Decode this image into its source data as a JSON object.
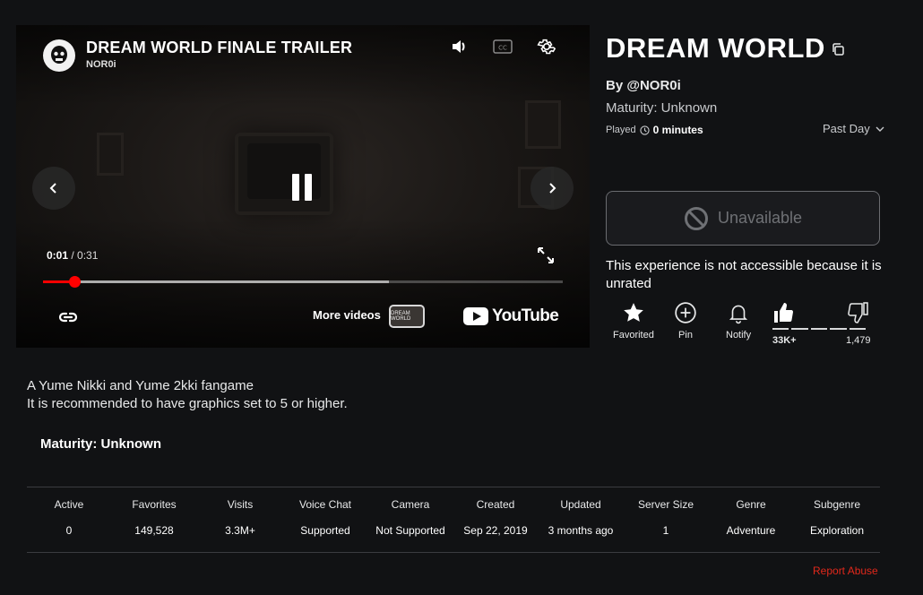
{
  "video": {
    "title": "DREAM WORLD FINALE TRAILER",
    "channel": "NOR0i",
    "current_time": "0:01",
    "duration": "/ 0:31",
    "progress_fraction": 0.06,
    "buffered_fraction": 0.665,
    "more_videos_label": "More videos",
    "more_thumb_text": "DREAM WORLD",
    "youtube_label": "YouTube",
    "icons": [
      "volume-icon",
      "captions-icon",
      "settings-icon",
      "prev-icon",
      "next-icon",
      "pause-icon",
      "fullscreen-icon",
      "link-icon"
    ]
  },
  "game": {
    "title": "DREAM WORLD",
    "by": "By @NOR0i",
    "maturity": "Maturity: Unknown",
    "played_label": "Played",
    "played_value": "0 minutes",
    "period": "Past Day",
    "unavailable_label": "Unavailable",
    "not_accessible": "This experience is not accessible because it is unrated"
  },
  "actions": {
    "favorited": "Favorited",
    "pin": "Pin",
    "notify": "Notify",
    "upvotes": "33K+",
    "downvotes": "1,479"
  },
  "description": {
    "line1": "A Yume Nikki and Yume 2kki fangame",
    "line2": "It is recommended to have graphics set to 5 or higher.",
    "maturity": "Maturity: Unknown"
  },
  "stats": [
    {
      "label": "Active",
      "value": "0"
    },
    {
      "label": "Favorites",
      "value": "149,528"
    },
    {
      "label": "Visits",
      "value": "3.3M+"
    },
    {
      "label": "Voice Chat",
      "value": "Supported"
    },
    {
      "label": "Camera",
      "value": "Not Supported"
    },
    {
      "label": "Created",
      "value": "Sep 22, 2019"
    },
    {
      "label": "Updated",
      "value": "3 months ago"
    },
    {
      "label": "Server Size",
      "value": "1"
    },
    {
      "label": "Genre",
      "value": "Adventure"
    },
    {
      "label": "Subgenre",
      "value": "Exploration"
    }
  ],
  "report_label": "Report Abuse",
  "colors": {
    "background": "#111214",
    "accent_red": "#ff0000",
    "report_red": "#e2281b",
    "muted_text": "#6f7175"
  }
}
